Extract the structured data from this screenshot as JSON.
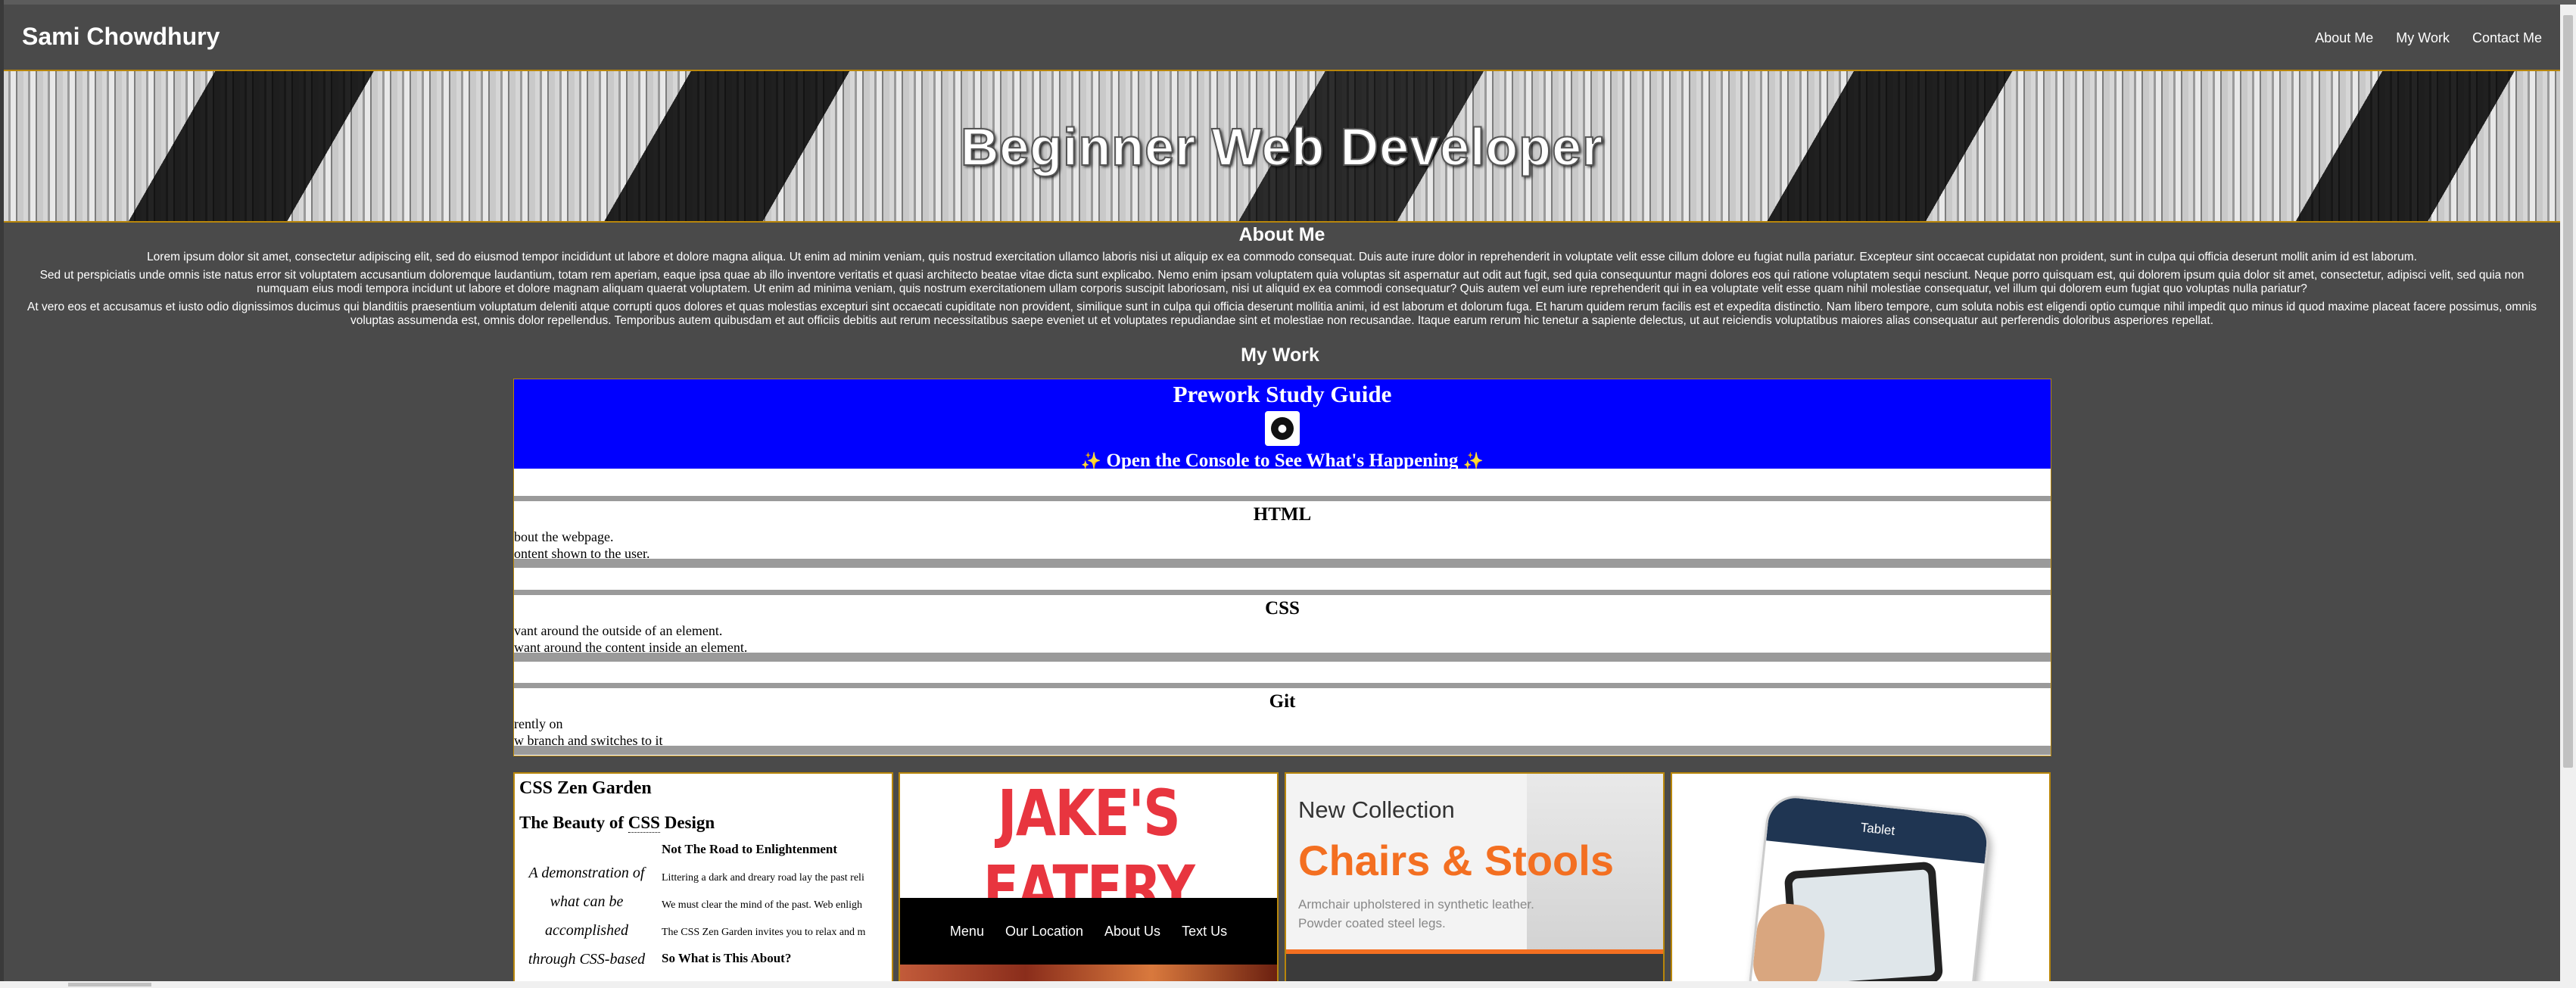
{
  "nav": {
    "brand": "Sami Chowdhury",
    "links": [
      "About Me",
      "My Work",
      "Contact Me"
    ]
  },
  "hero": {
    "title": "Beginner Web Developer"
  },
  "about": {
    "heading": "About Me",
    "paragraphs": [
      "Lorem ipsum dolor sit amet, consectetur adipiscing elit, sed do eiusmod tempor incididunt ut labore et dolore magna aliqua. Ut enim ad minim veniam, quis nostrud exercitation ullamco laboris nisi ut aliquip ex ea commodo consequat. Duis aute irure dolor in reprehenderit in voluptate velit esse cillum dolore eu fugiat nulla pariatur. Excepteur sint occaecat cupidatat non proident, sunt in culpa qui officia deserunt mollit anim id est laborum.",
      "Sed ut perspiciatis unde omnis iste natus error sit voluptatem accusantium doloremque laudantium, totam rem aperiam, eaque ipsa quae ab illo inventore veritatis et quasi architecto beatae vitae dicta sunt explicabo. Nemo enim ipsam voluptatem quia voluptas sit aspernatur aut odit aut fugit, sed quia consequuntur magni dolores eos qui ratione voluptatem sequi nesciunt. Neque porro quisquam est, qui dolorem ipsum quia dolor sit amet, consectetur, adipisci velit, sed quia non numquam eius modi tempora incidunt ut labore et dolore magnam aliquam quaerat voluptatem. Ut enim ad minima veniam, quis nostrum exercitationem ullam corporis suscipit laboriosam, nisi ut aliquid ex ea commodi consequatur? Quis autem vel eum iure reprehenderit qui in ea voluptate velit esse quam nihil molestiae consequatur, vel illum qui dolorem eum fugiat quo voluptas nulla pariatur?",
      "At vero eos et accusamus et iusto odio dignissimos ducimus qui blanditiis praesentium voluptatum deleniti atque corrupti quos dolores et quas molestias excepturi sint occaecati cupiditate non provident, similique sunt in culpa qui officia deserunt mollitia animi, id est laborum et dolorum fuga. Et harum quidem rerum facilis est et expedita distinctio. Nam libero tempore, cum soluta nobis est eligendi optio cumque nihil impedit quo minus id quod maxime placeat facere possimus, omnis voluptas assumenda est, omnis dolor repellendus. Temporibus autem quibusdam et aut officiis debitis aut rerum necessitatibus saepe eveniet ut et voluptates repudiandae sint et molestiae non recusandae. Itaque earum rerum hic tenetur a sapiente delectus, ut aut reiciendis voluptatibus maiores alias consequatur aut perferendis doloribus asperiores repellat."
    ]
  },
  "my_work": {
    "heading": "My Work"
  },
  "prework": {
    "title": "Prework Study Guide",
    "subtitle": "Open the Console to See What's Happening",
    "sparkle": "✨",
    "sections": [
      {
        "heading": "HTML",
        "line1": "bout the webpage.",
        "line2": "ontent shown to the user."
      },
      {
        "heading": "CSS",
        "line1": "vant around the outside of an element.",
        "line2": "want around the content inside an element."
      },
      {
        "heading": "Git",
        "line1": "rently on",
        "line2": "w branch and switches to it"
      }
    ]
  },
  "zen": {
    "title": "CSS Zen Garden",
    "subtitle_pre": "The Beauty of ",
    "subtitle_abbr": "CSS",
    "subtitle_post": " Design",
    "quote": "A demonstration of what can be accomplished through CSS-based",
    "heading_a": "Not The Road to Enlightenment",
    "para1": "Littering a dark and dreary road lay the past reli",
    "para2": "We must clear the mind of the past. Web enligh",
    "para3": "The CSS Zen Garden invites you to relax and m",
    "heading_b": "So What is This About?"
  },
  "jake": {
    "logo": "JAKE'S EATERY",
    "menu": [
      "Menu",
      "Our Location",
      "About Us",
      "Text Us"
    ]
  },
  "chairs": {
    "kicker": "New Collection",
    "title": "Chairs & Stools",
    "desc1": "Armchair upholstered in synthetic leather.",
    "desc2": "Powder coated steel legs."
  },
  "tablet": {
    "header": "Tablet"
  },
  "colors": {
    "accent": "#b8860b",
    "prework_blue": "#0000ff",
    "jake_red": "#e8353f",
    "chairs_orange": "#f36f21"
  },
  "icons": {
    "prework_badge": "robot-icon",
    "sparkle": "sparkle-icon"
  }
}
